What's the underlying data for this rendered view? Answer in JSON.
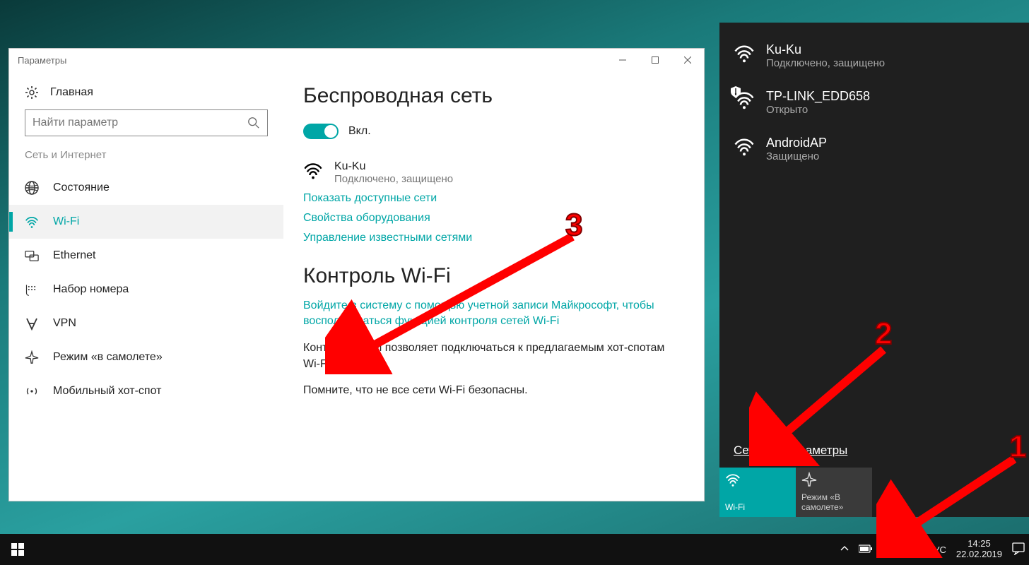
{
  "window": {
    "title": "Параметры",
    "home_label": "Главная",
    "search_placeholder": "Найти параметр",
    "category_label": "Сеть и Интернет",
    "nav": [
      {
        "id": "status",
        "label": "Состояние"
      },
      {
        "id": "wifi",
        "label": "Wi-Fi"
      },
      {
        "id": "ethernet",
        "label": "Ethernet"
      },
      {
        "id": "dialup",
        "label": "Набор номера"
      },
      {
        "id": "vpn",
        "label": "VPN"
      },
      {
        "id": "airplane",
        "label": "Режим «в самолете»"
      },
      {
        "id": "hotspot",
        "label": "Мобильный хот-спот"
      }
    ]
  },
  "content": {
    "heading": "Беспроводная сеть",
    "toggle_label": "Вкл.",
    "current_network": {
      "name": "Ku-Ku",
      "status": "Подключено, защищено"
    },
    "links": {
      "available": "Показать доступные сети",
      "hw_props": "Свойства оборудования",
      "known": "Управление известными сетями"
    },
    "wifi_control_heading": "Контроль Wi-Fi",
    "sign_in_link": "Войдите в систему с помощью учетной записи Майкрософт, чтобы воспользоваться функцией контроля сетей Wi-Fi",
    "paragraph1": "Контроль Wi-Fi позволяет подключаться к предлагаемым хот-спотам Wi-Fi.",
    "paragraph2": "Помните, что не все сети Wi-Fi безопасны."
  },
  "flyout": {
    "networks": [
      {
        "name": "Ku-Ku",
        "sub": "Подключено, защищено",
        "secure": true,
        "open": false
      },
      {
        "name": "TP-LINK_EDD658",
        "sub": "Открыто",
        "secure": false,
        "open": true
      },
      {
        "name": "AndroidAP",
        "sub": "Защищено",
        "secure": true,
        "open": false
      }
    ],
    "settings_link": "Сетевые параметры",
    "tiles": {
      "wifi": "Wi-Fi",
      "airplane": "Режим «В самолете»"
    }
  },
  "taskbar": {
    "lang": "РУС",
    "time": "14:25",
    "date": "22.02.2019"
  },
  "annotations": {
    "n1": "1",
    "n2": "2",
    "n3": "3"
  }
}
